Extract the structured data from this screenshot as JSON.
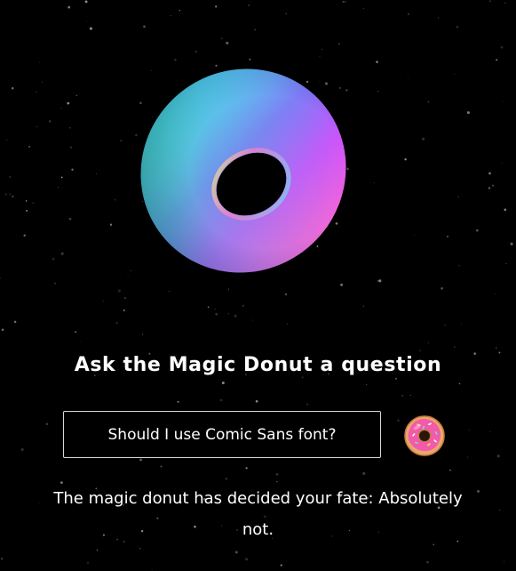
{
  "prompt": {
    "title": "Ask the Magic Donut a question"
  },
  "question_input": {
    "value": "Should I use Comic Sans font?"
  },
  "ask_button": {
    "icon": "pink-donut-icon"
  },
  "result": {
    "text": "The magic donut has decided your fate: Absolutely not."
  },
  "hero": {
    "icon": "rainbow-torus-3d"
  },
  "colors": {
    "background": "#000000",
    "text": "#ffffff",
    "input_border": "#d8d8d8",
    "donut_frosting": "#f25ba9",
    "donut_dough": "#e9a86a"
  }
}
